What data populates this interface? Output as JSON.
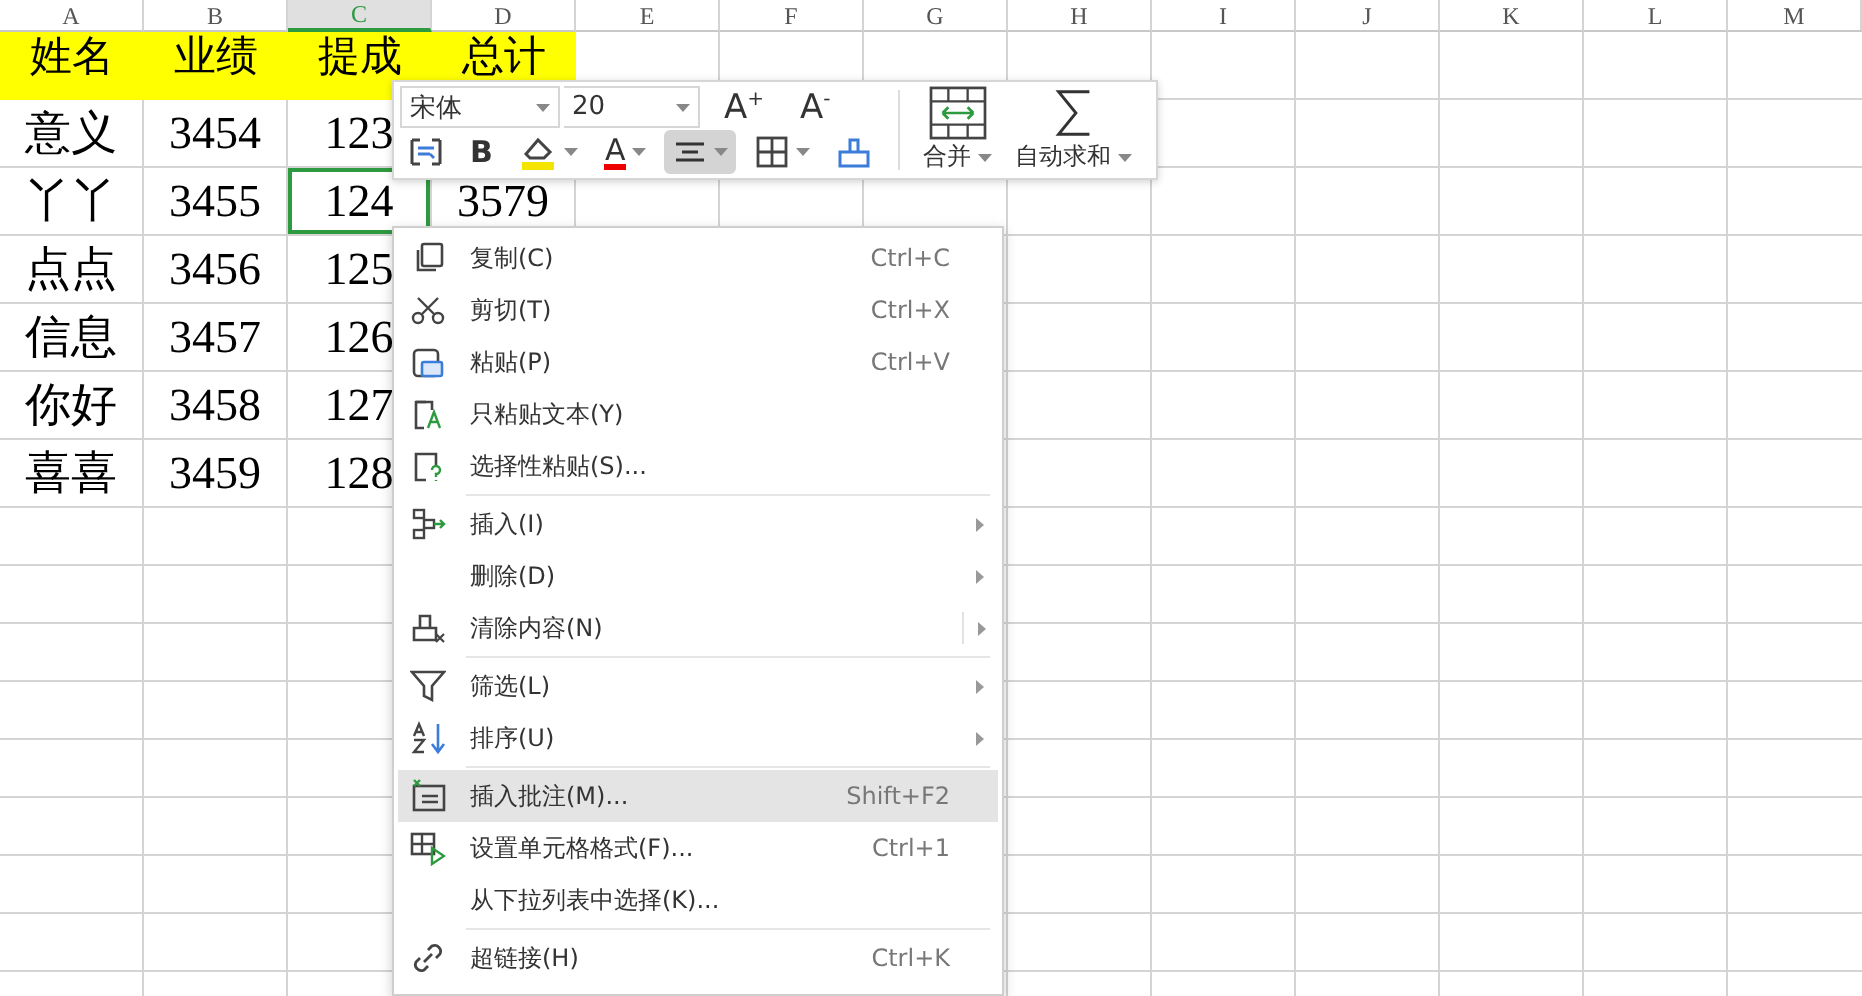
{
  "sheet": {
    "columns": [
      {
        "label": "A",
        "selected": false
      },
      {
        "label": "B",
        "selected": false
      },
      {
        "label": "C",
        "selected": true
      },
      {
        "label": "D",
        "selected": false
      },
      {
        "label": "E",
        "selected": false
      },
      {
        "label": "F",
        "selected": false
      },
      {
        "label": "G",
        "selected": false
      },
      {
        "label": "H",
        "selected": false
      },
      {
        "label": "I",
        "selected": false
      },
      {
        "label": "J",
        "selected": false
      },
      {
        "label": "K",
        "selected": false
      },
      {
        "label": "L",
        "selected": false
      },
      {
        "label": "M",
        "selected": false
      }
    ],
    "rows": [
      {
        "kind": "header",
        "cells": [
          {
            "text": "姓名",
            "selected": false
          },
          {
            "text": "业绩",
            "selected": false
          },
          {
            "text": "提成",
            "selected": false
          },
          {
            "text": "总计",
            "selected": false
          }
        ]
      },
      {
        "kind": "data",
        "cells": [
          {
            "text": "意义",
            "selected": false
          },
          {
            "text": "3454",
            "selected": false
          },
          {
            "text": "123",
            "selected": false
          }
        ]
      },
      {
        "kind": "data",
        "cells": [
          {
            "text": "丫丫",
            "selected": false
          },
          {
            "text": "3455",
            "selected": false
          },
          {
            "text": "124",
            "selected": true
          },
          {
            "text": "3579",
            "selected": false
          }
        ]
      },
      {
        "kind": "data",
        "cells": [
          {
            "text": "点点",
            "selected": false
          },
          {
            "text": "3456",
            "selected": false
          },
          {
            "text": "125",
            "selected": false
          }
        ]
      },
      {
        "kind": "data",
        "cells": [
          {
            "text": "信息",
            "selected": false
          },
          {
            "text": "3457",
            "selected": false
          },
          {
            "text": "126",
            "selected": false
          }
        ]
      },
      {
        "kind": "data",
        "cells": [
          {
            "text": "你好",
            "selected": false
          },
          {
            "text": "3458",
            "selected": false
          },
          {
            "text": "127",
            "selected": false
          }
        ]
      },
      {
        "kind": "data",
        "cells": [
          {
            "text": "喜喜",
            "selected": false
          },
          {
            "text": "3459",
            "selected": false
          },
          {
            "text": "128",
            "selected": false
          }
        ]
      }
    ]
  },
  "format_toolbar": {
    "font": "宋体",
    "size": "20",
    "grow_font": "A$^{+}$",
    "shrink_font": "A$^{-}$",
    "buttons": [
      {
        "kind": "wrap",
        "selected": false,
        "dropdown": false
      },
      {
        "kind": "bold",
        "label": "B",
        "selected": false,
        "dropdown": false
      },
      {
        "kind": "fill",
        "selected": false,
        "dropdown": true
      },
      {
        "kind": "font-color",
        "label": "A",
        "selected": false,
        "dropdown": true
      },
      {
        "kind": "align",
        "selected": true,
        "dropdown": true
      },
      {
        "kind": "border",
        "selected": false,
        "dropdown": true
      },
      {
        "kind": "painter",
        "selected": false,
        "dropdown": false
      }
    ],
    "large_buttons": [
      {
        "kind": "merge",
        "label": "合并",
        "dropdown": true
      },
      {
        "kind": "sum",
        "label": "自动求和",
        "dropdown": true
      }
    ]
  },
  "context_menu": {
    "items": [
      {
        "kind": "copy",
        "label": "复制(C)",
        "shortcut": "Ctrl+C",
        "submenu": false,
        "selected": false,
        "separator_before": false
      },
      {
        "kind": "cut",
        "label": "剪切(T)",
        "shortcut": "Ctrl+X",
        "submenu": false,
        "selected": false,
        "separator_before": false
      },
      {
        "kind": "paste",
        "label": "粘贴(P)",
        "shortcut": "Ctrl+V",
        "submenu": false,
        "selected": false,
        "separator_before": false
      },
      {
        "kind": "paste-text",
        "label": "只粘贴文本(Y)",
        "submenu": false,
        "selected": false,
        "separator_before": false
      },
      {
        "kind": "paste-special",
        "label": "选择性粘贴(S)...",
        "submenu": false,
        "selected": false,
        "separator_before": false
      },
      {
        "kind": "insert",
        "label": "插入(I)",
        "submenu": true,
        "selected": false,
        "separator_before": true
      },
      {
        "kind": "none",
        "label": "删除(D)",
        "submenu": true,
        "selected": false,
        "separator_before": false
      },
      {
        "kind": "clear",
        "label": "清除内容(N)",
        "submenu": true,
        "selected": false,
        "separator_before": false
      },
      {
        "kind": "filter",
        "label": "筛选(L)",
        "submenu": true,
        "selected": false,
        "separator_before": true
      },
      {
        "kind": "sort",
        "label": "排序(U)",
        "submenu": true,
        "selected": false,
        "separator_before": false
      },
      {
        "kind": "comment",
        "label": "插入批注(M)...",
        "shortcut": "Shift+F2",
        "submenu": false,
        "selected": true,
        "separator_before": true
      },
      {
        "kind": "format",
        "label": "设置单元格格式(F)...",
        "shortcut": "Ctrl+1",
        "submenu": false,
        "selected": false,
        "separator_before": false
      },
      {
        "kind": "none",
        "label": "从下拉列表中选择(K)...",
        "submenu": false,
        "selected": false,
        "separator_before": false
      },
      {
        "kind": "link",
        "label": "超链接(H)",
        "shortcut": "Ctrl+K",
        "submenu": false,
        "selected": false,
        "separator_before": true
      }
    ]
  }
}
